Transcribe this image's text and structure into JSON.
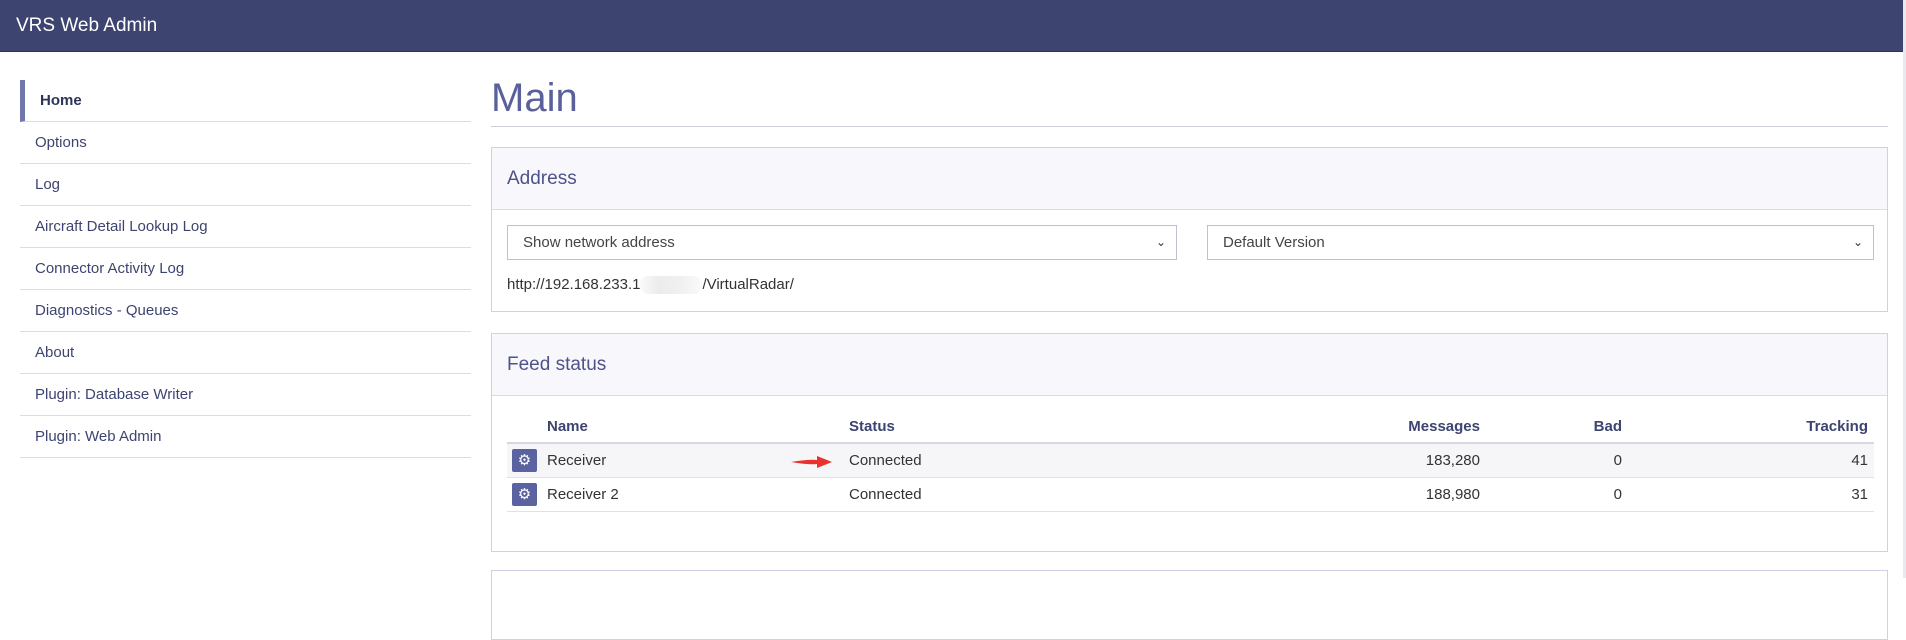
{
  "app": {
    "title": "VRS Web Admin"
  },
  "sidebar": {
    "items": [
      {
        "label": "Home",
        "active": true
      },
      {
        "label": "Options"
      },
      {
        "label": "Log"
      },
      {
        "label": "Aircraft Detail Lookup Log"
      },
      {
        "label": "Connector Activity Log"
      },
      {
        "label": "Diagnostics - Queues"
      },
      {
        "label": "About"
      },
      {
        "label": "Plugin: Database Writer"
      },
      {
        "label": "Plugin: Web Admin"
      }
    ]
  },
  "main": {
    "title": "Main",
    "address": {
      "heading": "Address",
      "network_select": "Show network address",
      "version_select": "Default Version",
      "url_prefix": "http://192.168.233.1",
      "url_suffix": "/VirtualRadar/"
    },
    "feed_status": {
      "heading": "Feed status",
      "columns": [
        "Name",
        "Status",
        "Messages",
        "Bad",
        "Tracking"
      ],
      "rows": [
        {
          "name": "Receiver",
          "status": "Connected",
          "messages": "183,280",
          "bad": "0",
          "tracking": "41"
        },
        {
          "name": "Receiver 2",
          "status": "Connected",
          "messages": "188,980",
          "bad": "0",
          "tracking": "31"
        }
      ]
    }
  },
  "icons": {
    "row_settings": "gear-icon",
    "select_arrow": "chevron-down-icon",
    "annotation": "red-arrow-icon"
  },
  "colors": {
    "navbar": "#3d4470",
    "accent": "#59609a",
    "button": "#5b62a0",
    "annotation_arrow": "#e8322f"
  }
}
